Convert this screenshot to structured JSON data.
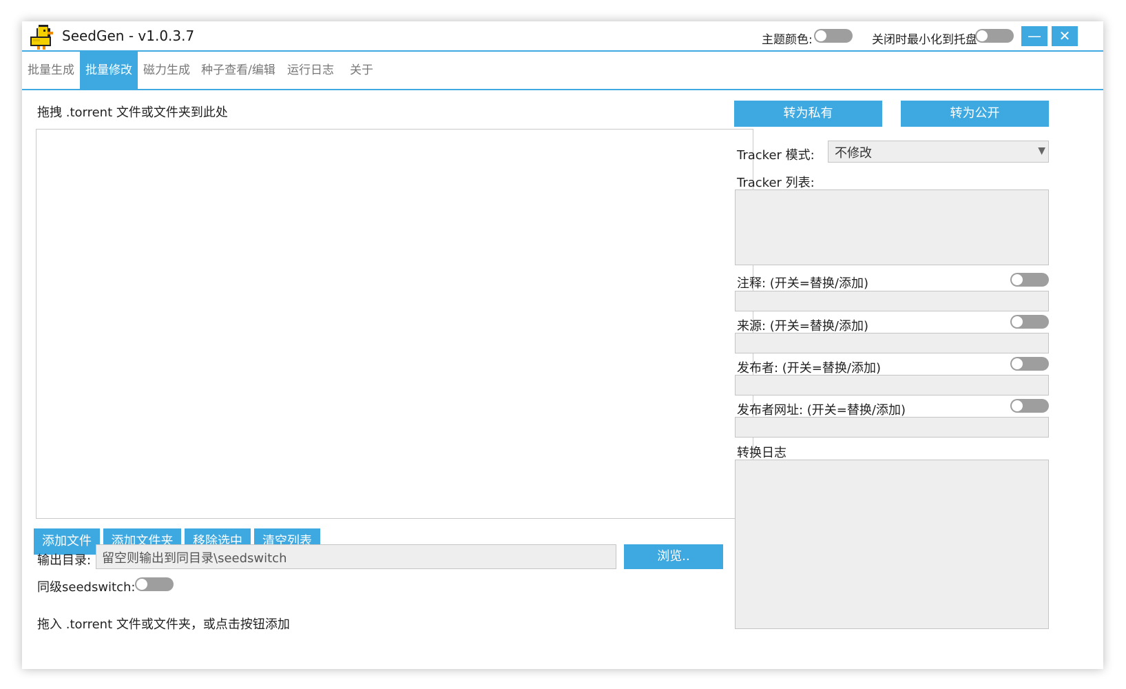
{
  "window": {
    "title": "SeedGen - v1.0.3.7",
    "theme_label": "主题颜色:",
    "tray_label": "关闭时最小化到托盘",
    "minimize_glyph": "—",
    "close_glyph": "✕"
  },
  "tabs": [
    {
      "label": "批量生成",
      "active": false
    },
    {
      "label": "批量修改",
      "active": true
    },
    {
      "label": "磁力生成",
      "active": false
    },
    {
      "label": "种子查看/编辑",
      "active": false
    },
    {
      "label": "运行日志",
      "active": false
    },
    {
      "label": "关于",
      "active": false
    }
  ],
  "left": {
    "drop_label": "拖拽 .torrent 文件或文件夹到此处",
    "buttons": {
      "add_file": "添加文件",
      "add_folder": "添加文件夹",
      "remove_selected": "移除选中",
      "clear_list": "清空列表"
    },
    "output": {
      "label": "输出目录:",
      "placeholder": "留空则输出到同目录\\seedswitch",
      "browse": "浏览.."
    },
    "same_level_label": "同级seedswitch:",
    "status_text": "拖入 .torrent 文件或文件夹，或点击按钮添加"
  },
  "right": {
    "to_private": "转为私有",
    "to_public": "转为公开",
    "tracker_mode_label": "Tracker 模式:",
    "tracker_mode_value": "不修改",
    "tracker_list_label": "Tracker 列表:",
    "comment_label": "注释: (开关=替换/添加)",
    "source_label": "来源: (开关=替换/添加)",
    "publisher_label": "发布者: (开关=替换/添加)",
    "publisher_url_label": "发布者网址: (开关=替换/添加)",
    "log_label": "转换日志"
  },
  "colors": {
    "accent": "#3da9e0",
    "toggle_off": "#9e9e9e",
    "input_bg": "#eeeeee",
    "logo_yellow": "#f5d000"
  },
  "icons": {
    "logo": "duck-logo-icon",
    "dropdown": "chevron-down-icon"
  }
}
